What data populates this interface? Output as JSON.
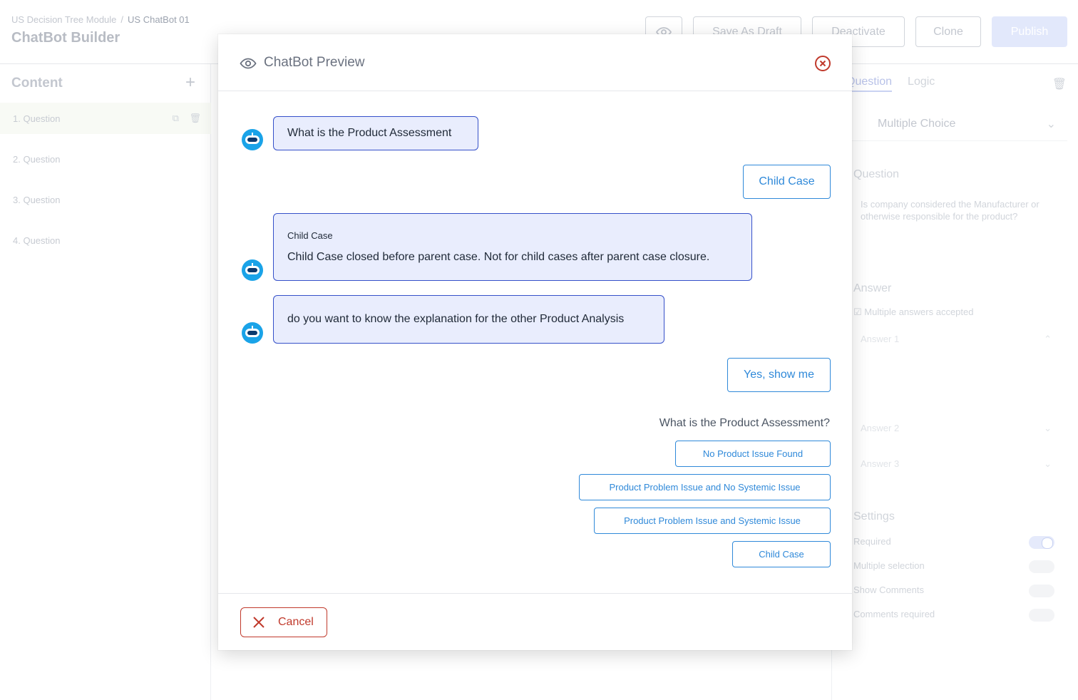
{
  "background": {
    "breadcrumb": [
      "US Decision Tree Module",
      "US ChatBot 01"
    ],
    "page_title": "ChatBot Builder",
    "toolbar": {
      "save_draft": "Save As Draft",
      "deactivate": "Deactivate",
      "clone": "Clone",
      "publish": "Publish"
    },
    "sidebar": {
      "title": "Content",
      "items": [
        "1. Question",
        "2. Question",
        "3. Question",
        "4. Question"
      ]
    },
    "panel": {
      "tabs": [
        "Question",
        "Logic"
      ],
      "type": "Multiple Choice",
      "question_label": "Question",
      "question_text": "Is company considered the Manufacturer or otherwise responsible for the product?",
      "answer_label": "Answer",
      "multi_answers": "Multiple answers accepted",
      "answers": [
        "Answer 1",
        "Answer 2",
        "Answer 3"
      ],
      "settings_label": "Settings",
      "settings": [
        "Required",
        "Multiple selection",
        "Show Comments",
        "Comments required"
      ]
    }
  },
  "modal": {
    "title": "ChatBot Preview",
    "messages": [
      {
        "from": "bot",
        "text": "What is the Product Assessment"
      },
      {
        "from": "user",
        "text": "Child Case"
      },
      {
        "from": "bot",
        "subtitle": "Child Case",
        "text": "Child Case closed before parent case. Not for child cases after parent case closure."
      },
      {
        "from": "bot",
        "text": "do you want to know the explanation for the other Product Analysis"
      },
      {
        "from": "user",
        "text": "Yes, show me"
      }
    ],
    "prompt": "What is the Product Assessment?",
    "options": [
      "No Product Issue Found",
      "Product Problem Issue and No Systemic Issue",
      "Product Problem Issue and Systemic Issue",
      "Child Case"
    ],
    "cancel_label": "Cancel",
    "colors": {
      "accent": "#2f89d9",
      "bot_bubble_bg": "#e9edfd",
      "bot_bubble_border": "#3550c9",
      "cancel": "#c0392b",
      "bot_avatar": "#1aa3e8"
    }
  }
}
